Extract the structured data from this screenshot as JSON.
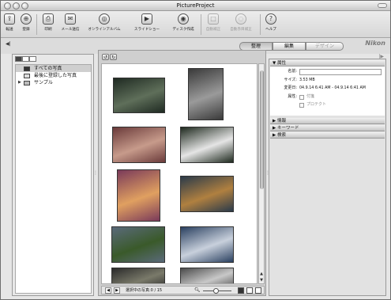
{
  "window": {
    "title": "PictureProject"
  },
  "toolbar": {
    "buttons": [
      {
        "label": "転送",
        "icon": "transfer-icon",
        "enabled": true
      },
      {
        "label": "登録",
        "icon": "register-icon",
        "enabled": true
      },
      {
        "label": "印刷",
        "icon": "print-icon",
        "enabled": true
      },
      {
        "label": "メール送信",
        "icon": "mail-icon",
        "enabled": true
      },
      {
        "label": "オンラインアルバム",
        "icon": "online-album-icon",
        "enabled": true
      },
      {
        "label": "スライドショー",
        "icon": "slideshow-icon",
        "enabled": true
      },
      {
        "label": "ディスク作成",
        "icon": "disc-burn-icon",
        "enabled": true
      },
      {
        "label": "自動補正",
        "icon": "auto-enhance-icon",
        "enabled": false
      },
      {
        "label": "自動赤目補正",
        "icon": "red-eye-icon",
        "enabled": false
      },
      {
        "label": "ヘルプ",
        "icon": "help-icon",
        "enabled": true
      }
    ]
  },
  "mode_tabs": [
    {
      "label": "整理",
      "selected": true,
      "enabled": true
    },
    {
      "label": "編集",
      "selected": false,
      "enabled": true
    },
    {
      "label": "デザイン",
      "selected": false,
      "enabled": false
    }
  ],
  "brand": "Nikon",
  "sidebar": {
    "items": [
      {
        "label": "すべての写真",
        "icon": "all-photos-icon",
        "selected": true
      },
      {
        "label": "最後に登録した写真",
        "icon": "last-import-icon",
        "selected": false
      },
      {
        "label": "サンプル",
        "icon": "folder-icon",
        "selected": false,
        "expandable": true
      }
    ]
  },
  "gallery": {
    "selection_text": "選択中の写真:0 / 15",
    "thumbnails": [
      {
        "subject": "water lilies",
        "colors": [
          "#1f2a22",
          "#5f6f5a"
        ]
      },
      {
        "subject": "lotus flower",
        "colors": [
          "#3a3a3a",
          "#9a9a9a"
        ]
      },
      {
        "subject": "rose",
        "colors": [
          "#6a3a3a",
          "#c79b8b"
        ]
      },
      {
        "subject": "white flowers",
        "colors": [
          "#1f2a1f",
          "#e5e5e5"
        ]
      },
      {
        "subject": "flower garden",
        "colors": [
          "#7a3a5a",
          "#e0a060"
        ]
      },
      {
        "subject": "mandarin duck",
        "colors": [
          "#2a3a4a",
          "#b08040"
        ]
      },
      {
        "subject": "park landscape",
        "colors": [
          "#5a6a7a",
          "#3a5a2a"
        ]
      },
      {
        "subject": "mountain sky",
        "colors": [
          "#2a4060",
          "#c8d0dc"
        ]
      },
      {
        "subject": "partial photo 1",
        "colors": [
          "#2a2a2a",
          "#7a7a6a"
        ]
      },
      {
        "subject": "partial photo 2",
        "colors": [
          "#4a4a4a",
          "#c8c8c8"
        ]
      }
    ]
  },
  "info_panel": {
    "attributes": {
      "header": "属性",
      "name_label": "名前:",
      "name_value": "",
      "size_label": "サイズ:",
      "size_value": "3.53 MB",
      "modified_label": "変更日:",
      "modified_value": "04.9.14 6:41 AM - 04.9.14 6:41 AM",
      "flags_label": "属性:",
      "flag1": "付箋",
      "flag2": "プロテクト"
    },
    "sections": [
      "情報",
      "キーワード",
      "検索"
    ]
  }
}
